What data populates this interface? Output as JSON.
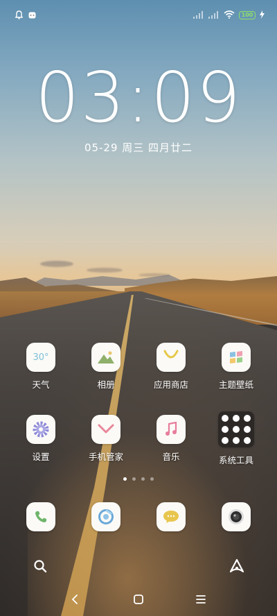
{
  "status_bar": {
    "left_icons": [
      "lock-notification-icon",
      "message-notification-icon"
    ],
    "right_icons": [
      "signal-icon",
      "signal-icon",
      "wifi-icon",
      "battery-icon",
      "charging-icon"
    ],
    "battery_level": "100"
  },
  "lock": {
    "time": "03:09",
    "date": "05-29 周三 四月廿二"
  },
  "apps_row1": [
    {
      "label": "天气",
      "icon": "weather-icon",
      "icon_text": "30°"
    },
    {
      "label": "相册",
      "icon": "gallery-icon"
    },
    {
      "label": "应用商店",
      "icon": "app-store-icon"
    },
    {
      "label": "主题壁纸",
      "icon": "themes-icon"
    }
  ],
  "apps_row2": [
    {
      "label": "设置",
      "icon": "settings-icon"
    },
    {
      "label": "手机管家",
      "icon": "phone-manager-icon"
    },
    {
      "label": "音乐",
      "icon": "music-icon"
    },
    {
      "label": "系统工具",
      "icon": "folder-icon"
    }
  ],
  "pager": {
    "pages": 4,
    "active": 0
  },
  "dock": [
    {
      "icon": "phone-icon"
    },
    {
      "icon": "browser-icon"
    },
    {
      "icon": "messages-icon"
    },
    {
      "icon": "camera-icon"
    }
  ],
  "bottom_bar": {
    "left_icon": "search-icon",
    "right_icon": "assistant-icon"
  },
  "navbar": {
    "icons": [
      "back-icon",
      "home-icon",
      "menu-icon"
    ]
  },
  "colors": {
    "battery": "#8ee06a",
    "tile_bg": "#fbfaf7",
    "gallery_green": "#8fb06a",
    "store_yellow": "#e6c84a",
    "settings_purple": "#8e8ad8",
    "manager_pink": "#e9879a",
    "music_pink": "#e77d9b",
    "phone_green": "#6fb56a",
    "browser_blue": "#6aa8d8",
    "message_yellow": "#e8c64e"
  }
}
